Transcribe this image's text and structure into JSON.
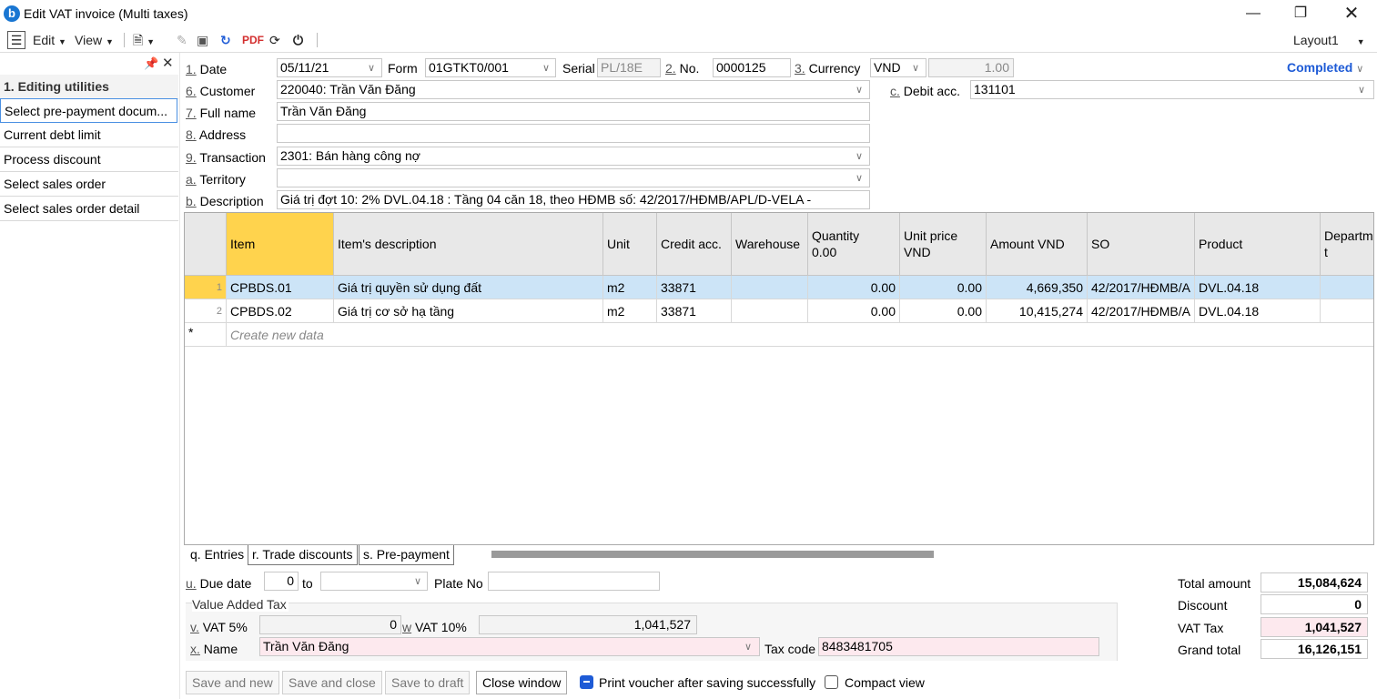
{
  "window": {
    "title": "Edit VAT invoice (Multi taxes)",
    "logo_letter": "b"
  },
  "toolbar": {
    "edit": "Edit",
    "view": "View",
    "layout": "Layout1"
  },
  "sidebar": {
    "header": "1. Editing utilities",
    "items": [
      "Select pre-payment docum...",
      "Current debt limit",
      "Process discount",
      "Select sales order",
      "Select sales order detail"
    ]
  },
  "status": "Completed",
  "form": {
    "date_num": "1.",
    "date_label": "Date",
    "date_value": "05/11/21",
    "form_label": "Form",
    "form_value": "01GTKT0/001",
    "serial_label": "Serial",
    "serial_value": "PL/18E",
    "no_num": "2.",
    "no_label": "No.",
    "no_value": "0000125",
    "currency_num": "3.",
    "currency_label": "Currency",
    "currency_value": "VND",
    "rate": "1.00",
    "customer_num": "6.",
    "customer_label": "Customer",
    "customer_value": "220040: Trần Văn Đăng",
    "debit_num": "c.",
    "debit_label": "Debit acc.",
    "debit_value": "131101",
    "fullname_num": "7.",
    "fullname_label": "Full name",
    "fullname_value": "Trần Văn Đăng",
    "address_num": "8.",
    "address_label": "Address",
    "address_value": "",
    "transaction_num": "9.",
    "transaction_label": "Transaction",
    "transaction_value": "2301: Bán hàng công nợ",
    "territory_num": "a.",
    "territory_label": "Territory",
    "territory_value": "",
    "description_num": "b.",
    "description_label": "Description",
    "description_value": "Giá trị đợt  10: 2% DVL.04.18 : Tầng 04 căn 18, theo HĐMB số: 42/2017/HĐMB/APL/D-VELA -"
  },
  "grid": {
    "headers": {
      "item": "Item",
      "desc": "Item's description",
      "unit": "Unit",
      "credit": "Credit acc.",
      "warehouse": "Warehouse",
      "qty": "Quantity",
      "qty_sub": "0.00",
      "price": "Unit price",
      "price_sub": "VND",
      "amount": "Amount VND",
      "so": "SO",
      "product": "Product",
      "dept": "Departm",
      "dept2": "t"
    },
    "rows": [
      {
        "n": "1",
        "item": "CPBDS.01",
        "desc": "Giá trị quyền sử dụng đất",
        "unit": "m2",
        "credit": "33871",
        "warehouse": "",
        "qty": "0.00",
        "price": "0.00",
        "amount": "4,669,350",
        "so": "42/2017/HĐMB/A",
        "product": "DVL.04.18",
        "dept": ""
      },
      {
        "n": "2",
        "item": "CPBDS.02",
        "desc": "Giá trị cơ sở hạ tầng",
        "unit": "m2",
        "credit": "33871",
        "warehouse": "",
        "qty": "0.00",
        "price": "0.00",
        "amount": "10,415,274",
        "so": "42/2017/HĐMB/A",
        "product": "DVL.04.18",
        "dept": ""
      }
    ],
    "new_row_marker": "*",
    "new_row": "Create new data"
  },
  "tabs": [
    "q. Entries",
    "r. Trade discounts",
    "s. Pre-payment"
  ],
  "bottom": {
    "due_num": "u.",
    "due_label": "Due date",
    "due_value": "0",
    "to_label": "to",
    "to_value": "",
    "plate_label": "Plate No",
    "plate_value": "",
    "vat_group": "Value Added Tax",
    "vat5_num": "v.",
    "vat5_label": "VAT 5%",
    "vat5_value": "0",
    "vat10_num": "w",
    "vat10_label": "VAT 10%",
    "vat10_value": "1,041,527",
    "name_num": "x.",
    "name_label": "Name",
    "name_value": "Trần Văn Đăng",
    "taxcode_label": "Tax code",
    "taxcode_value": "8483481705"
  },
  "totals": {
    "total_label": "Total amount",
    "total": "15,084,624",
    "discount_label": "Discount",
    "discount": "0",
    "vat_label": "VAT Tax",
    "vat": "1,041,527",
    "grand_label": "Grand total",
    "grand": "16,126,151"
  },
  "buttons": {
    "save_new": "Save and new",
    "save_close": "Save and close",
    "save_draft": "Save to draft",
    "close": "Close window",
    "print": "Print voucher after saving successfully",
    "compact": "Compact view"
  },
  "colors": {
    "accent": "#1e5bd6",
    "selected_row": "#cce4f7",
    "item_header": "#ffd34d",
    "pink": "#fde9ee"
  }
}
